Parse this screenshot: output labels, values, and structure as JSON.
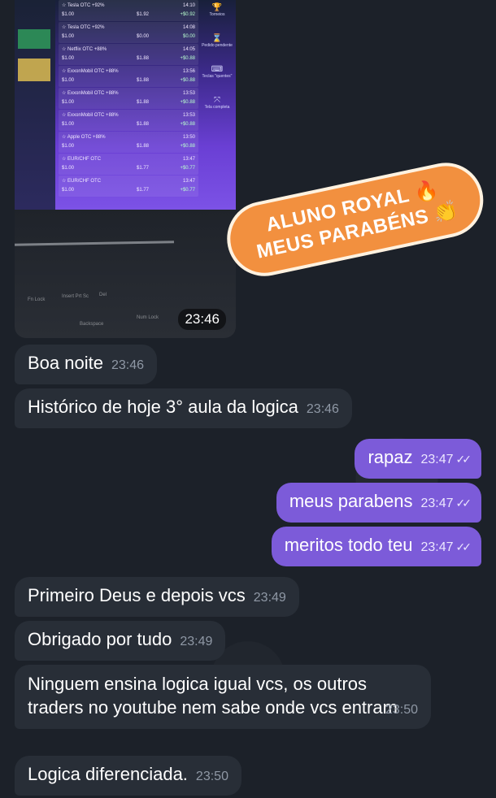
{
  "photo": {
    "trades": [
      {
        "name": "☆ Tesla OTC +92%",
        "amount": "$1.00",
        "value": "$1.92",
        "time": "14:10",
        "result": "+$0.92"
      },
      {
        "name": "☆ Tesla OTC +92%",
        "amount": "$1.00",
        "value": "$0.00",
        "time": "14:08",
        "result": "$0.00"
      },
      {
        "name": "☆ Netflix OTC +88%",
        "amount": "$1.00",
        "value": "$1.88",
        "time": "14:05",
        "result": "+$0.88"
      },
      {
        "name": "☆ ExxonMobil OTC +88%",
        "amount": "$1.00",
        "value": "$1.88",
        "time": "13:56",
        "result": "+$0.88"
      },
      {
        "name": "☆ ExxonMobil OTC +88%",
        "amount": "$1.00",
        "value": "$1.88",
        "time": "13:53",
        "result": "+$0.88"
      },
      {
        "name": "☆ ExxonMobil OTC +88%",
        "amount": "$1.00",
        "value": "$1.88",
        "time": "13:53",
        "result": "+$0.88"
      },
      {
        "name": "☆ Apple OTC +88%",
        "amount": "$1.00",
        "value": "$1.88",
        "time": "13:50",
        "result": "+$0.88"
      },
      {
        "name": "☆ EUR/CHF OTC",
        "amount": "$1.00",
        "value": "$1.77",
        "time": "13:47",
        "result": "+$0.77"
      },
      {
        "name": "☆ EUR/CHF OTC",
        "amount": "$1.00",
        "value": "$1.77",
        "time": "13:47",
        "result": "+$0.77"
      }
    ],
    "side_tools": [
      {
        "icon": "trophy-icon",
        "glyph": "🏆",
        "label": "Torneios"
      },
      {
        "icon": "hourglass-icon",
        "glyph": "⌛",
        "label": "Pedido pendente"
      },
      {
        "icon": "keyboard-icon",
        "glyph": "⌨",
        "label": "Teclas \"quentes\""
      },
      {
        "icon": "expand-icon",
        "glyph": "⤧",
        "label": "Tela completa"
      }
    ],
    "keyboard": {
      "fn": "Fn Lock",
      "insert": "Insert Prt Sc",
      "del": "Del",
      "backspace": "Backspace",
      "numlock": "Num Lock"
    },
    "time": "23:46"
  },
  "sticker": {
    "line1": "ALUNO ROYAL 🔥",
    "line2": "MEUS PARABÉNS 👏"
  },
  "messages": [
    {
      "dir": "in",
      "text": "Boa noite",
      "time": "23:46"
    },
    {
      "dir": "in",
      "text": "Histórico de hoje 3° aula da logica",
      "time": "23:46"
    },
    {
      "dir": "out",
      "text": "rapaz",
      "time": "23:47",
      "ticks": "✓✓"
    },
    {
      "dir": "out",
      "text": "meus parabens",
      "time": "23:47",
      "ticks": "✓✓"
    },
    {
      "dir": "out",
      "text": "meritos todo teu",
      "time": "23:47",
      "ticks": "✓✓"
    },
    {
      "dir": "in",
      "text": "Primeiro Deus e depois vcs",
      "time": "23:49"
    },
    {
      "dir": "in",
      "text": "Obrigado por tudo",
      "time": "23:49"
    },
    {
      "dir": "in",
      "text": "Ninguem ensina logica igual vcs, os outros traders no youtube nem sabe onde vcs entram",
      "time": "23:50"
    },
    {
      "dir": "in",
      "text": "Logica diferenciada.",
      "time": "23:50"
    }
  ]
}
